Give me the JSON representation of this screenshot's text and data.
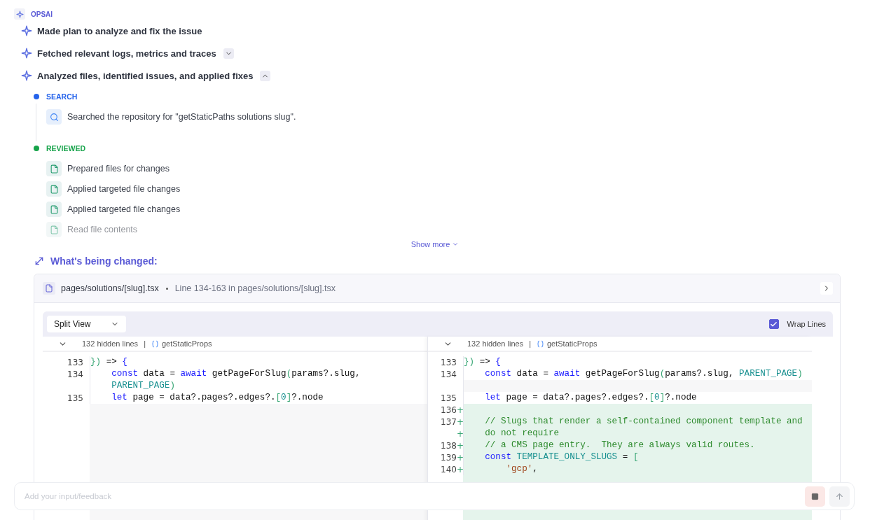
{
  "header": {
    "label": "OPSAI"
  },
  "steps": [
    {
      "text": "Made plan to analyze and fix the issue"
    },
    {
      "text": "Fetched relevant logs, metrics and traces",
      "expanded": false
    },
    {
      "text": "Analyzed files, identified issues, and applied fixes",
      "expanded": true
    }
  ],
  "sections": [
    {
      "title": "SEARCH",
      "color": "#2563eb",
      "items": [
        {
          "kind": "search",
          "text": "Searched the repository for \"getStaticPaths solutions slug\"."
        }
      ]
    },
    {
      "title": "REVIEWED",
      "color": "#16a34a",
      "items": [
        {
          "kind": "file",
          "text": "Prepared files for changes"
        },
        {
          "kind": "file",
          "text": "Applied targeted file changes"
        },
        {
          "kind": "file",
          "text": "Applied targeted file changes"
        },
        {
          "kind": "file",
          "text": "Read file contents"
        }
      ]
    }
  ],
  "show_more": "Show more",
  "changes": {
    "title": "What's being changed:",
    "file": "pages/solutions/[slug].tsx",
    "range": "Line 134-163 in pages/solutions/[slug].tsx",
    "view_select": "Split View",
    "wrap_lines": {
      "label": "Wrap Lines",
      "checked": true
    },
    "panes": [
      {
        "hidden": "132 hidden lines",
        "separator": "|",
        "symbol": "getStaticProps",
        "lines": [
          {
            "num": "133",
            "kind": "context",
            "tokens": [
              {
                "kind": "bracket",
                "text": "})"
              },
              {
                "kind": "plain",
                "text": " => "
              },
              {
                "kind": "brace",
                "text": "{"
              }
            ]
          },
          {
            "num": "134",
            "kind": "context",
            "tokens": [
              {
                "kind": "keyword",
                "text": "    const"
              },
              {
                "kind": "plain",
                "text": " data = "
              },
              {
                "kind": "keyword",
                "text": "await"
              },
              {
                "kind": "plain",
                "text": " getPageForSlug"
              },
              {
                "kind": "bracket",
                "text": "("
              },
              {
                "kind": "plain",
                "text": "params?.slug,"
              }
            ]
          },
          {
            "kind": "context",
            "tokens": [
              {
                "kind": "const",
                "text": "    PARENT_PAGE"
              },
              {
                "kind": "bracket",
                "text": ")"
              }
            ]
          },
          {
            "num": "135",
            "kind": "context",
            "tokens": [
              {
                "kind": "keyword",
                "text": "    let"
              },
              {
                "kind": "plain",
                "text": " page = data?.pages?.edges?."
              },
              {
                "kind": "bracket",
                "text": "["
              },
              {
                "kind": "const",
                "text": "0"
              },
              {
                "kind": "bracket",
                "text": "]"
              },
              {
                "kind": "plain",
                "text": "?.node"
              }
            ]
          }
        ]
      },
      {
        "hidden": "132 hidden lines",
        "separator": "|",
        "symbol": "getStaticProps",
        "lines": [
          {
            "num": "133",
            "kind": "context",
            "tokens": [
              {
                "kind": "bracket",
                "text": "})"
              },
              {
                "kind": "plain",
                "text": " => "
              },
              {
                "kind": "brace",
                "text": "{"
              }
            ]
          },
          {
            "num": "134",
            "kind": "context",
            "tokens": [
              {
                "kind": "keyword",
                "text": "    const"
              },
              {
                "kind": "plain",
                "text": " data = "
              },
              {
                "kind": "keyword",
                "text": "await"
              },
              {
                "kind": "plain",
                "text": " getPageForSlug"
              },
              {
                "kind": "bracket",
                "text": "("
              },
              {
                "kind": "plain",
                "text": "params?.slug, "
              },
              {
                "kind": "const",
                "text": "PARENT_PAGE"
              },
              {
                "kind": "bracket",
                "text": ")"
              }
            ]
          },
          {
            "kind": "filler"
          },
          {
            "num": "135",
            "kind": "context",
            "tokens": [
              {
                "kind": "keyword",
                "text": "    let"
              },
              {
                "kind": "plain",
                "text": " page = data?.pages?.edges?."
              },
              {
                "kind": "bracket",
                "text": "["
              },
              {
                "kind": "const",
                "text": "0"
              },
              {
                "kind": "bracket",
                "text": "]"
              },
              {
                "kind": "plain",
                "text": "?.node"
              }
            ]
          },
          {
            "num": "136",
            "marker": "+",
            "kind": "added"
          },
          {
            "num": "137",
            "marker": "+",
            "kind": "added",
            "tokens": [
              {
                "kind": "comment",
                "text": "    // Slugs that render a self-contained component template and"
              }
            ]
          },
          {
            "marker": "+",
            "kind": "added",
            "tokens": [
              {
                "kind": "comment",
                "text": "    do not require"
              }
            ]
          },
          {
            "num": "138",
            "marker": "+",
            "kind": "added",
            "tokens": [
              {
                "kind": "comment",
                "text": "    // a CMS page entry.  They are always valid routes."
              }
            ]
          },
          {
            "num": "139",
            "marker": "+",
            "kind": "added",
            "tokens": [
              {
                "kind": "keyword",
                "text": "    const"
              },
              {
                "kind": "const",
                "text": " TEMPLATE_ONLY_SLUGS"
              },
              {
                "kind": "plain",
                "text": " = "
              },
              {
                "kind": "bracket",
                "text": "["
              }
            ]
          },
          {
            "num": "140",
            "marker": "+",
            "kind": "added",
            "tokens": [
              {
                "kind": "string",
                "text": "        'gcp'"
              },
              {
                "kind": "plain",
                "text": ","
              }
            ]
          }
        ]
      }
    ]
  },
  "input": {
    "placeholder": "Add your input/feedback"
  }
}
